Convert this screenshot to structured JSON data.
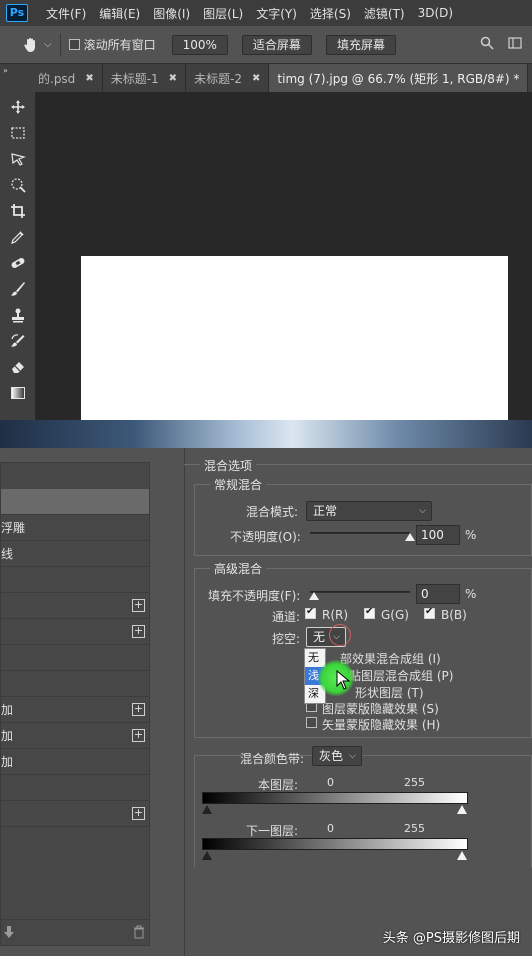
{
  "menubar": {
    "logo": "Ps",
    "items": [
      "文件(F)",
      "编辑(E)",
      "图像(I)",
      "图层(L)",
      "文字(Y)",
      "选择(S)",
      "滤镜(T)",
      "3D(D)"
    ]
  },
  "options": {
    "scroll_all_label": "滚动所有窗口",
    "zoom_value": "100%",
    "fit_screen_label": "适合屏幕",
    "fill_screen_label": "填充屏幕"
  },
  "tabs": [
    {
      "label": "的.psd",
      "close": "✖"
    },
    {
      "label": "未标题-1",
      "close": "✖"
    },
    {
      "label": "未标题-2",
      "close": "✖"
    },
    {
      "label": "timg (7).jpg @ 66.7% (矩形 1, RGB/8#) *",
      "close": "✖"
    }
  ],
  "style_list": {
    "rows": [
      {
        "label": "",
        "plus": false,
        "selected": true
      },
      {
        "label": "浮雕",
        "plus": false
      },
      {
        "label": "线",
        "plus": false
      },
      {
        "label": "",
        "plus": false
      },
      {
        "label": "",
        "plus": true
      },
      {
        "label": "",
        "plus": true
      },
      {
        "label": "",
        "plus": false
      },
      {
        "label": "",
        "plus": false
      },
      {
        "label": "加",
        "plus": true
      },
      {
        "label": "加",
        "plus": true
      },
      {
        "label": "加",
        "plus": false
      },
      {
        "label": "",
        "plus": false
      },
      {
        "label": "",
        "plus": true
      }
    ],
    "plus_symbol": "+"
  },
  "blending": {
    "section_title": "混合选项",
    "general_title": "常规混合",
    "mode_label": "混合模式:",
    "mode_value": "正常",
    "opacity_label": "不透明度(O):",
    "opacity_value": "100",
    "opacity_unit": "%",
    "opacity_level": 1.0,
    "advanced_title": "高级混合",
    "fill_label": "填充不透明度(F):",
    "fill_value": "0",
    "fill_unit": "%",
    "fill_level": 0.0,
    "channels_label": "通道:",
    "channel_r": "R(R)",
    "channel_g": "G(G)",
    "channel_b": "B(B)",
    "knockout_label": "挖空:",
    "knockout_value": "无",
    "knockout_options": [
      "无",
      "浅",
      "深"
    ],
    "opt_blend_interior": "将内部效果混合成组 (I)",
    "opt_blend_interior_visible": "部效果混合成组 (I)",
    "opt_blend_clipped_visible": "贴图层混合成组 (P)",
    "opt_transparency_visible": "形状图层 (T)",
    "opt_layer_mask": "图层蒙版隐藏效果 (S)",
    "opt_vector_mask": "矢量蒙版隐藏效果 (H)",
    "blend_if_label": "混合颜色带:",
    "blend_if_value": "灰色",
    "this_layer_label": "本图层:",
    "this_layer_min": "0",
    "this_layer_max": "255",
    "underlying_label": "下一图层:",
    "underlying_min": "0",
    "underlying_max": "255"
  },
  "watermark": "头条 @PS摄影修图后期",
  "colors": {
    "accent_blue": "#3b78d8",
    "cursor_glow": "#39d53a"
  }
}
